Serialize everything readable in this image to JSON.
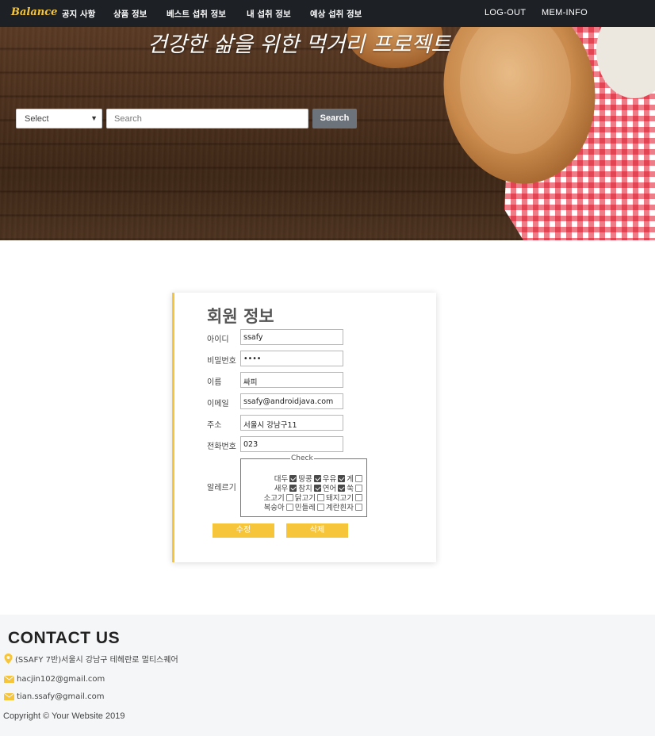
{
  "nav": {
    "brand": "Balance",
    "links": [
      "공지 사항",
      "상품 정보",
      "베스트 섭취 정보",
      "내 섭취 정보",
      "예상 섭취 정보"
    ],
    "logout": "LOG-OUT",
    "meminfo": "MEM-INFO"
  },
  "hero": {
    "title": "건강한 삶을 위한 먹거리 프로젝트",
    "select_value": "Select",
    "search_placeholder": "Search",
    "search_button": "Search"
  },
  "member": {
    "title": "회원 정보",
    "fields": [
      {
        "label": "아이디",
        "value": "ssafy"
      },
      {
        "label": "비밀번호",
        "value": "••••"
      },
      {
        "label": "이름",
        "value": "싸피"
      },
      {
        "label": "이메일",
        "value": "ssafy@androidjava.com"
      },
      {
        "label": "주소",
        "value": "서울시 강남구11"
      },
      {
        "label": "전화번호",
        "value": "023"
      }
    ],
    "allergy_label": "알레르기",
    "legend": "Check",
    "allergy_rows": [
      [
        {
          "name": "대두",
          "checked": true
        },
        {
          "name": "땅콩",
          "checked": true
        },
        {
          "name": "우유",
          "checked": true
        },
        {
          "name": "게",
          "checked": false
        }
      ],
      [
        {
          "name": "새우",
          "checked": true
        },
        {
          "name": "참치",
          "checked": true
        },
        {
          "name": "연어",
          "checked": true
        },
        {
          "name": "쑥",
          "checked": false
        }
      ],
      [
        {
          "name": "소고기",
          "checked": false
        },
        {
          "name": "닭고기",
          "checked": false
        },
        {
          "name": "돼지고기",
          "checked": false
        }
      ],
      [
        {
          "name": "복숭아",
          "checked": false
        },
        {
          "name": "민들레",
          "checked": false
        },
        {
          "name": "계란흰자",
          "checked": false
        }
      ]
    ],
    "edit_button": "수정",
    "delete_button": "삭제"
  },
  "footer": {
    "title": "CONTACT US",
    "address": "(SSAFY 7반)서울시 강남구 테헤란로 멀티스퀘어",
    "email1": "hacjin102@gmail.com",
    "email2": "tian.ssafy@gmail.com",
    "copyright": "Copyright © Your Website 2019"
  },
  "colors": {
    "accent": "#f6c53a",
    "navbar": "#1d2126",
    "search_button": "#6c737a",
    "footer_bg": "#f5f6f8"
  }
}
